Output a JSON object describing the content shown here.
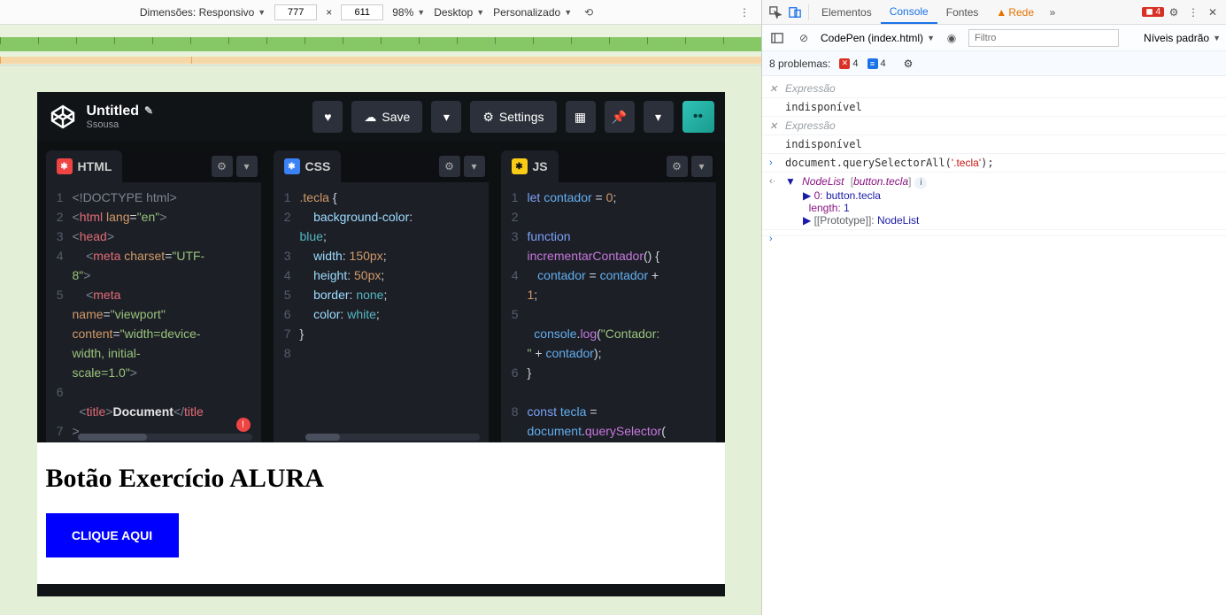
{
  "device_toolbar": {
    "dimensions_label": "Dimensões: Responsivo",
    "width": "777",
    "height": "611",
    "zoom": "98%",
    "throttle": "Desktop",
    "custom": "Personalizado"
  },
  "codepen": {
    "title": "Untitled",
    "author": "Ssousa",
    "save": "Save",
    "settings": "Settings",
    "panels": {
      "html": "HTML",
      "css": "CSS",
      "js": "JS"
    }
  },
  "code": {
    "html_lines": [
      "1",
      "2",
      "3",
      "4",
      " ",
      "5",
      " ",
      " ",
      " ",
      " ",
      "6",
      " ",
      "7"
    ],
    "css_lines": [
      "1",
      "2",
      " ",
      "3",
      "4",
      "5",
      "6",
      "7",
      "8"
    ],
    "js_lines": [
      "1",
      "2",
      "3",
      " ",
      "4",
      " ",
      "5",
      " ",
      " ",
      "6",
      " ",
      "8",
      " "
    ]
  },
  "result": {
    "heading": "Botão Exercício ALURA",
    "button": "CLIQUE AQUI"
  },
  "devtools": {
    "tabs": {
      "elements": "Elementos",
      "console": "Console",
      "sources": "Fontes",
      "network": "Rede"
    },
    "error_count": "4",
    "context": "CodePen (index.html)",
    "filter_placeholder": "Filtro",
    "levels": "Níveis padrão",
    "problems_label": "8 problemas:",
    "problems_err": "4",
    "problems_info": "4",
    "watch_placeholder": "Expressão",
    "watch_unavailable": "indisponível",
    "cmd": "document.querySelectorAll('.tecla');",
    "result_nodelist": "NodeList [button.tecla]",
    "result_item_key": "0:",
    "result_item_val": "button.tecla",
    "result_len_key": "length:",
    "result_len_val": "1",
    "result_proto": "[[Prototype]]: NodeList"
  }
}
